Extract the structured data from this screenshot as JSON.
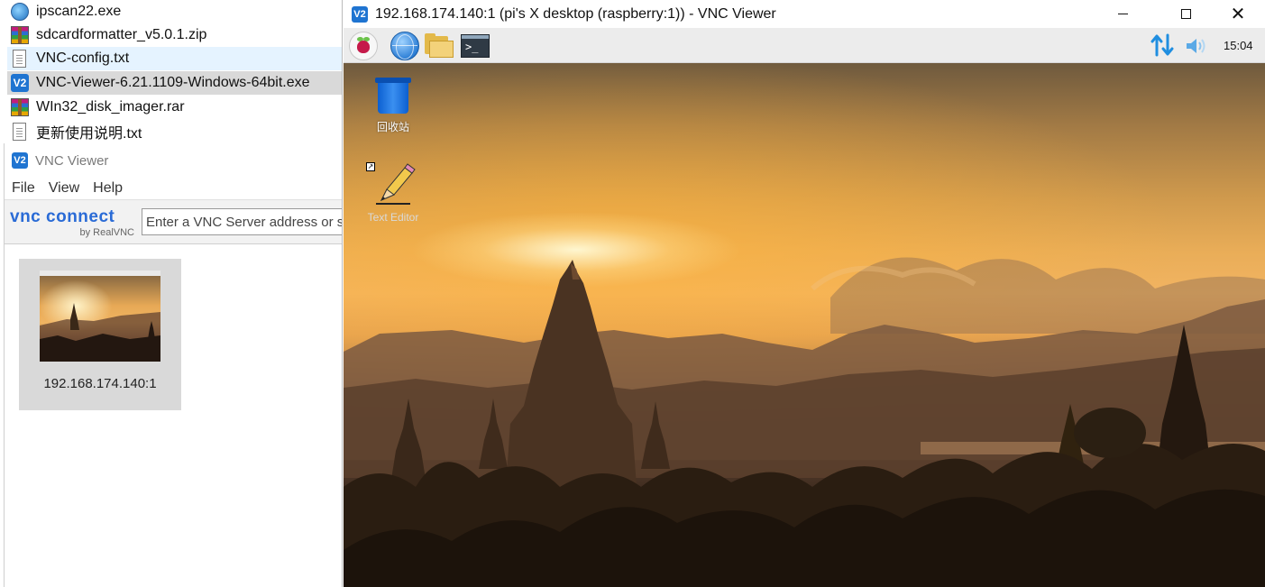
{
  "explorer": {
    "files": [
      {
        "name": "ipscan22.exe",
        "icon": "ipscan-icon"
      },
      {
        "name": "sdcardformatter_v5.0.1.zip",
        "icon": "winrar-archive-icon"
      },
      {
        "name": "VNC-config.txt",
        "icon": "text-file-icon"
      },
      {
        "name": "VNC-Viewer-6.21.1109-Windows-64bit.exe",
        "icon": "vnc-viewer-icon"
      },
      {
        "name": "WIn32_disk_imager.rar",
        "icon": "winrar-archive-icon"
      },
      {
        "name": "更新使用说明.txt",
        "icon": "text-file-icon"
      }
    ]
  },
  "vnc_viewer": {
    "logo_glyph": "V2",
    "title": "VNC Viewer",
    "menu": [
      "File",
      "View",
      "Help"
    ],
    "brand": "vnc connect",
    "brand_sub": "by RealVNC",
    "address_placeholder": "Enter a VNC Server address or search",
    "connection": {
      "label": "192.168.174.140:1"
    }
  },
  "session": {
    "title": "192.168.174.140:1 (pi's X desktop (raspberry:1)) - VNC Viewer",
    "panel": {
      "clock": "15:04"
    },
    "desktop_icons": [
      {
        "label": "回收站",
        "icon": "trash-icon"
      },
      {
        "label": "Text Editor",
        "icon": "text-editor-icon"
      }
    ]
  },
  "colors": {
    "vnc_blue": "#1f74d1",
    "panel_bg": "#ececec",
    "selection": "#d9d9d9",
    "hover": "#e5f3ff"
  }
}
